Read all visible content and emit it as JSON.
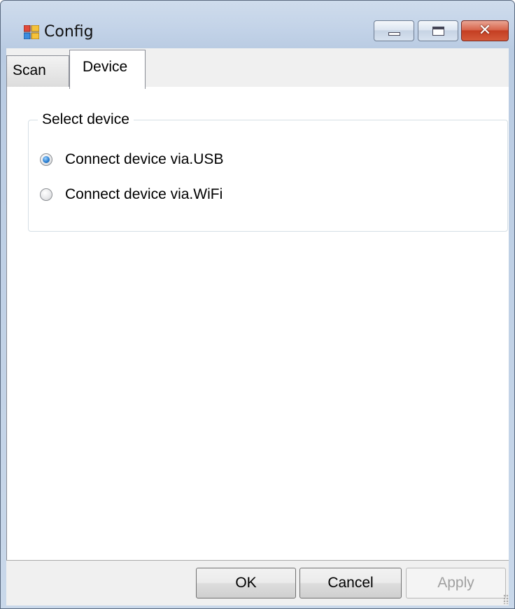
{
  "window": {
    "title": "Config",
    "close_glyph": "✕"
  },
  "tabs": [
    {
      "label": "Scan",
      "selected": false
    },
    {
      "label": "Device",
      "selected": true
    }
  ],
  "device_group": {
    "legend": "Select device",
    "options": [
      {
        "label": "Connect device via.USB",
        "checked": true
      },
      {
        "label": "Connect device via.WiFi",
        "checked": false
      }
    ]
  },
  "buttons": {
    "ok": "OK",
    "cancel": "Cancel",
    "apply": "Apply"
  },
  "icons": {
    "app": "window-app-icon",
    "minimize": "minimize-icon",
    "maximize": "maximize-icon",
    "close": "close-icon"
  },
  "colors": {
    "radio_checked": "#2b7fd1",
    "close_button": "#c43e22",
    "disabled_text": "#a0a0a0"
  }
}
